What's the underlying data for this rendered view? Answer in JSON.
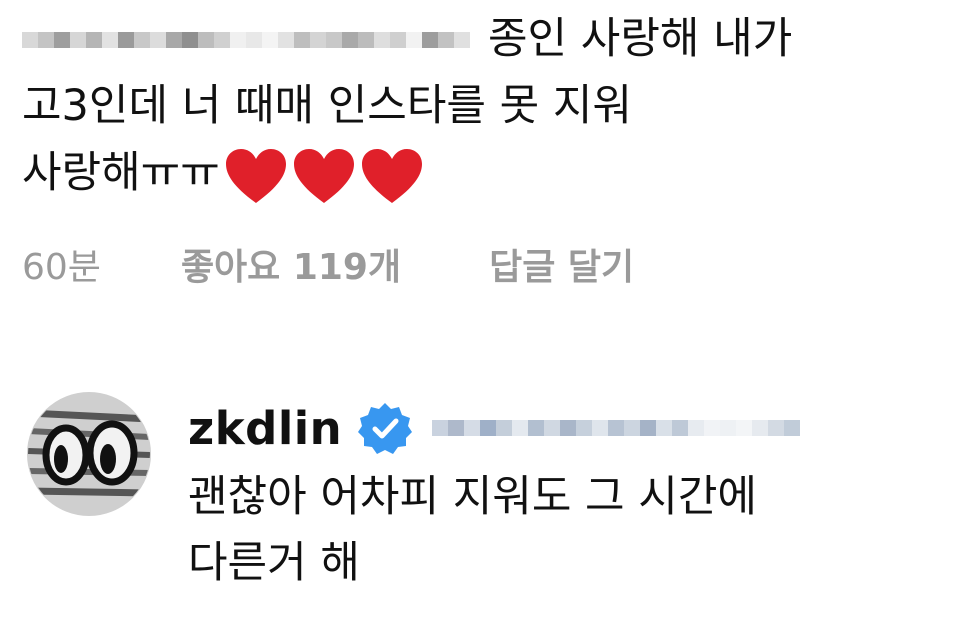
{
  "comment": {
    "line1_text": "종인 사랑해 내가",
    "line2_text": "고3인데 너 때매 인스타를 못 지워",
    "line3_text": "사랑해ㅠㅠ",
    "hearts": [
      "red-heart-icon",
      "red-heart-icon",
      "red-heart-icon"
    ],
    "heart_color": "#e0202a"
  },
  "meta": {
    "time": "60분",
    "likes": "좋아요 119개",
    "reply_label": "답글 달기"
  },
  "reply": {
    "username": "zkdlin",
    "verified_color": "#3897f0",
    "line1_text": "괜찮아 어차피 지워도 그 시간에",
    "line2_text": "다른거 해"
  }
}
